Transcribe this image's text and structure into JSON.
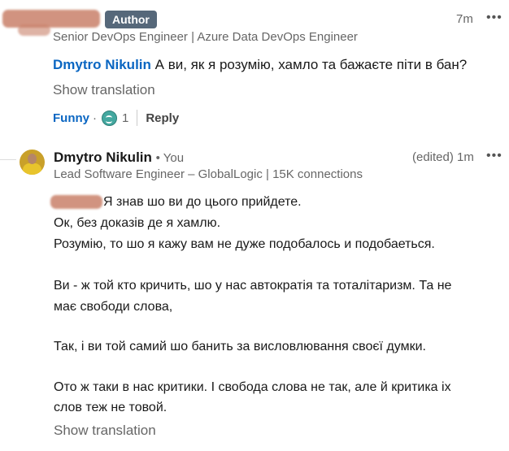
{
  "comment1": {
    "badge": "Author",
    "time": "7m",
    "menu": "•••",
    "subtitle": "Senior DevOps Engineer | Azure Data DevOps Engineer",
    "mention": "Dmytro Nikulin",
    "text": " А ви, як я розумію, хамло та бажаєте піти в бан?",
    "show_translation": "Show translation",
    "reaction_label": "Funny",
    "reaction_sep": "·",
    "reaction_count": "1",
    "reply_label": "Reply"
  },
  "comment2": {
    "author": "Dmytro Nikulin",
    "you": "• You",
    "time": "(edited)  1m",
    "menu": "•••",
    "subtitle": "Lead Software Engineer – GlobalLogic | 15K connections",
    "lines": [
      "Я знав шо ви до цього прийдете.",
      "Ок, без доказів де я хамлю.",
      "Розумію, то шо я кажу вам не дуже подобалось и подобаеться.",
      "Ви - ж той кто кричить, шо у нас автократія та тоталітаризм. Та не",
      "має свободи слова,",
      "Так, і ви той самий шо банить за висловлювання своєї думки.",
      "Ото ж таки в нас критики. І свобода слова не так, але й критика іх",
      "слов теж не товой."
    ],
    "show_translation": "Show translation"
  }
}
